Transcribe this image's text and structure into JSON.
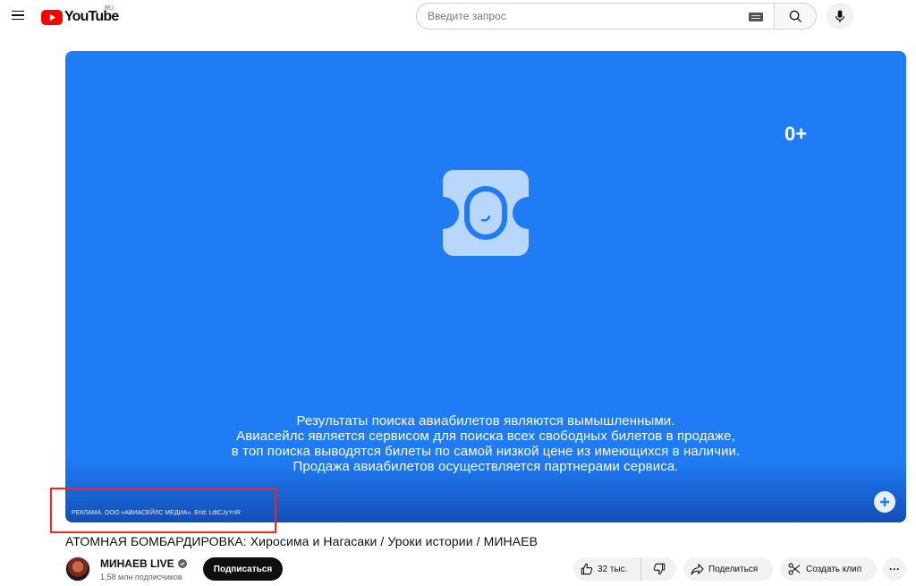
{
  "header": {
    "logo_text": "YouTube",
    "region": "RU",
    "search_placeholder": "Введите запрос"
  },
  "player": {
    "age_rating": "0+",
    "background_color": "#1f7cf5",
    "disclaimer_lines": [
      "Результаты поиска авиабилетов являются вымышленными.",
      "Авиасейлс является сервисом для поиска всех свободных билетов в продаже,",
      "в топ поиска выводятся билеты по самой низкой цене из имеющихся в наличии.",
      "Продажа авиабилетов осуществляется партнерами сервиса."
    ],
    "ad_label": "РЕКЛАМА. ООО «АВИАСЕЙЛС МЕДИА». Erid: LdtCJyYnR"
  },
  "video": {
    "title": "АТОМНАЯ БОМБАРДИРОВКА: Хиросима и Нагасаки / Уроки истории / МИНАЕВ"
  },
  "channel": {
    "name": "МИНАЕВ LIVE",
    "subscribers": "1,58 млн подписчиков",
    "subscribe_label": "Подписаться"
  },
  "actions": {
    "likes": "32 тыс.",
    "share_label": "Поделиться",
    "clip_label": "Создать клип",
    "more_label": "···"
  },
  "colors": {
    "brand_red": "#ff0000",
    "annotation_red": "#ff2020"
  }
}
